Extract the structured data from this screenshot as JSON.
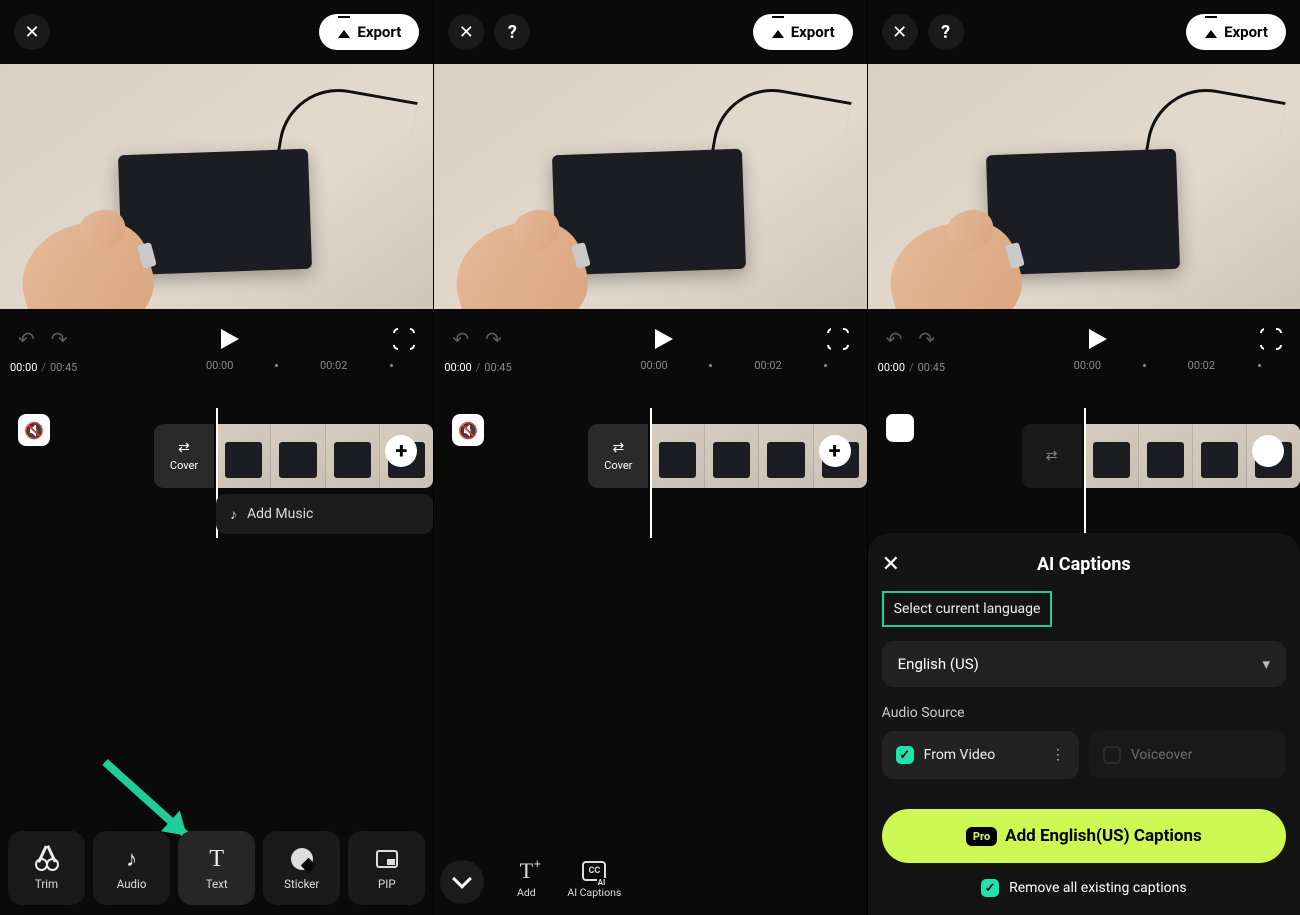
{
  "common": {
    "export": "Export",
    "time_current": "00:00",
    "time_total": "00:45",
    "tick_00": "00:00",
    "tick_02": "00:02",
    "cover": "Cover",
    "add_music": "Add Music"
  },
  "panel1": {
    "tools": {
      "trim": "Trim",
      "audio": "Audio",
      "text": "Text",
      "sticker": "Sticker",
      "pip": "PIP"
    }
  },
  "panel2": {
    "tools": {
      "add": "Add",
      "ai_captions": "AI Captions"
    }
  },
  "panel3": {
    "sheet": {
      "title": "AI Captions",
      "select_lang": "Select current language",
      "lang": "English (US)",
      "audio_source": "Audio Source",
      "from_video": "From Video",
      "voiceover": "Voiceover",
      "pro": "Pro",
      "cta": "Add English(US) Captions",
      "remove": "Remove all existing captions"
    }
  }
}
